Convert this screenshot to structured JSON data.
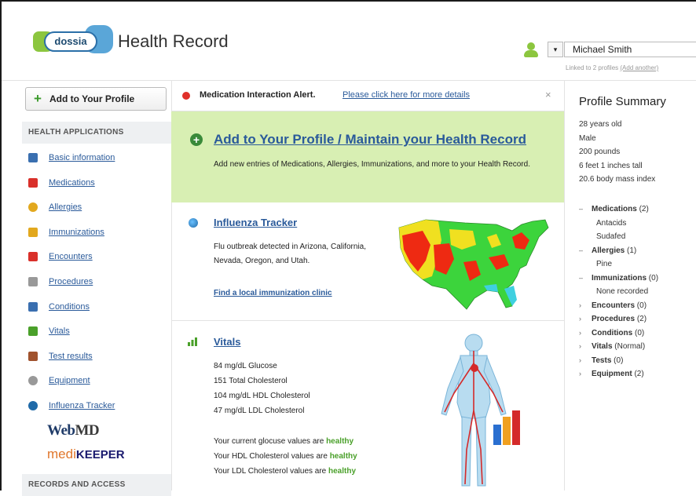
{
  "header": {
    "logo_text": "dossia",
    "title": "Health Record",
    "user_dropdown_glyph": "▾",
    "user_name": "Michael Smith",
    "linked_text": "Linked to 2 profiles",
    "linked_link": "(Add another)"
  },
  "sidebar": {
    "add_button": "Add to Your Profile",
    "section_health": "HEALTH APPLICATIONS",
    "items": [
      {
        "label": "Basic information",
        "icon": "id-card-icon",
        "color": "#3a6fb0"
      },
      {
        "label": "Medications",
        "icon": "pill-icon",
        "color": "#d9302a"
      },
      {
        "label": "Allergies",
        "icon": "allergy-icon",
        "color": "#e2a81e"
      },
      {
        "label": "Immunizations",
        "icon": "shield-icon",
        "color": "#e2a81e"
      },
      {
        "label": "Encounters",
        "icon": "calendar-icon",
        "color": "#d9302a"
      },
      {
        "label": "Procedures",
        "icon": "document-icon",
        "color": "#999999"
      },
      {
        "label": "Conditions",
        "icon": "flag-icon",
        "color": "#3a6fb0"
      },
      {
        "label": "Vitals",
        "icon": "chart-icon",
        "color": "#4aa02a"
      },
      {
        "label": "Test results",
        "icon": "clipboard-icon",
        "color": "#a0522d"
      },
      {
        "label": "Equipment",
        "icon": "gear-icon",
        "color": "#999999"
      },
      {
        "label": "Influenza Tracker",
        "icon": "globe-icon",
        "color": "#1f6aa8"
      }
    ],
    "partner_webmd_a": "Web",
    "partner_webmd_b": "MD",
    "partner_medi": "medi",
    "partner_keeper": "KEEPER",
    "section_records": "RECORDS AND ACCESS"
  },
  "alert": {
    "title": "Medication Interaction Alert.",
    "link": "Please click here for more details",
    "close": "×"
  },
  "green_panel": {
    "plus": "+",
    "heading": "Add to Your Profile / Maintain your Health Record",
    "text": "Add new entries of Medications, Allergies, Immunizations, and more to your Health Record."
  },
  "influenza": {
    "heading": "Influenza Tracker",
    "description": "Flu outbreak detected in Arizona, California, Nevada, Oregon, and Utah.",
    "link": "Find a local immunization clinic"
  },
  "vitals": {
    "heading": "Vitals",
    "readings": [
      "84 mg/dL Glucose",
      "151 Total Cholesterol",
      "104 mg/dL HDL Cholesterol",
      "47 mg/dL LDL Cholesterol"
    ],
    "status": [
      {
        "prefix": "Your current glocuse values are",
        "value": "healthy"
      },
      {
        "prefix": "Your HDL Cholesterol values are",
        "value": "healthy"
      },
      {
        "prefix": "Your LDL Cholesterol values are",
        "value": "healthy"
      }
    ]
  },
  "summary": {
    "title": "Profile Summary",
    "facts": [
      "28 years old",
      "Male",
      "200 pounds",
      "6 feet 1 inches tall",
      "20.6 body mass index"
    ],
    "groups": [
      {
        "toggle": "–",
        "name": "Medications",
        "count": "(2)",
        "subs": [
          "Antacids",
          "Sudafed"
        ]
      },
      {
        "toggle": "–",
        "name": "Allergies",
        "count": "(1)",
        "subs": [
          "Pine"
        ]
      },
      {
        "toggle": "–",
        "name": "Immunizations",
        "count": "(0)",
        "subs": [
          "None recorded"
        ]
      },
      {
        "toggle": "›",
        "name": "Encounters",
        "count": "(0)",
        "subs": []
      },
      {
        "toggle": "›",
        "name": "Procedures",
        "count": "(2)",
        "subs": []
      },
      {
        "toggle": "›",
        "name": "Conditions",
        "count": "(0)",
        "subs": []
      },
      {
        "toggle": "›",
        "name": "Vitals",
        "count": "(Normal)",
        "subs": []
      },
      {
        "toggle": "›",
        "name": "Tests",
        "count": "(0)",
        "subs": []
      },
      {
        "toggle": "›",
        "name": "Equipment",
        "count": "(2)",
        "subs": []
      }
    ]
  },
  "colors": {
    "brand_green": "#8cc63f",
    "brand_blue": "#5aa6d8",
    "link_blue": "#2a5a9a",
    "panel_green": "#d8efb3",
    "alert_red": "#e0302a"
  }
}
